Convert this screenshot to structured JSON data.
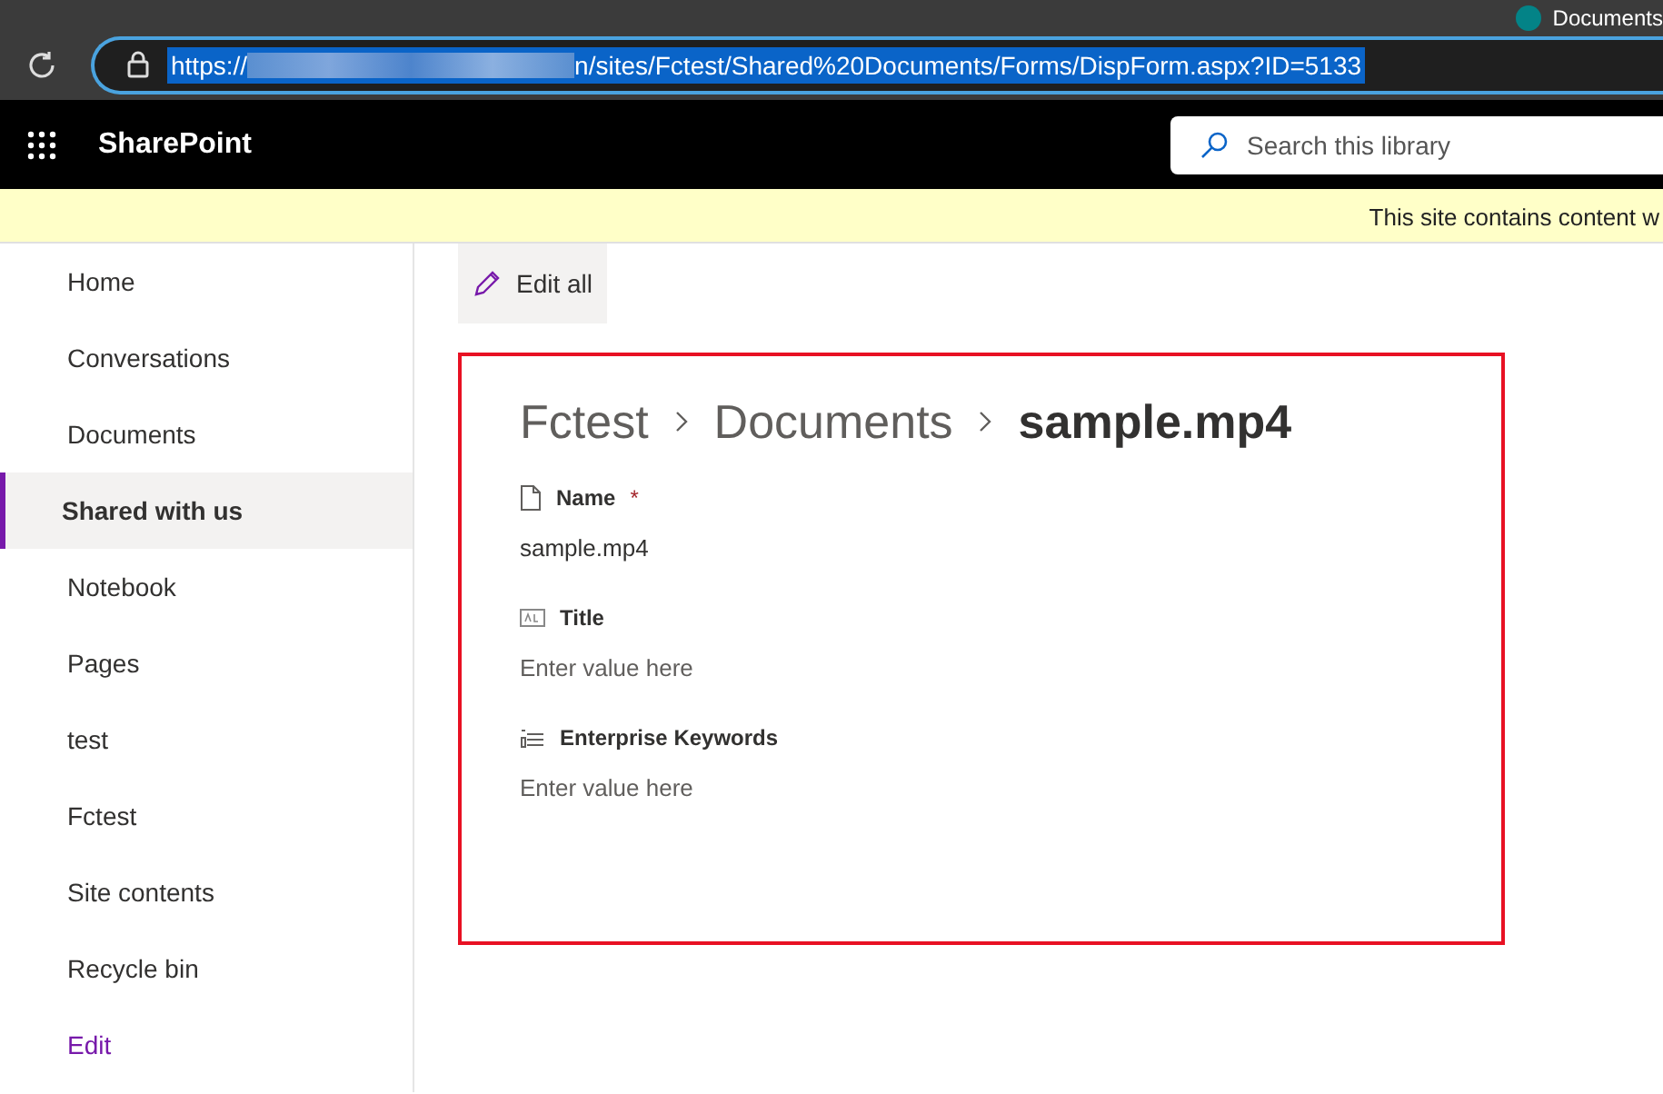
{
  "browser": {
    "tab_title": "Documents",
    "url_prefix": "https://",
    "url_suffix": "n/sites/Fctest/Shared%20Documents/Forms/DispForm.aspx?ID=5133"
  },
  "suite_bar": {
    "app_name": "SharePoint",
    "search": {
      "placeholder": "Search this library"
    }
  },
  "banner": {
    "text": "This site contains content w"
  },
  "nav": [
    {
      "label": "Home",
      "selected": false
    },
    {
      "label": "Conversations",
      "selected": false
    },
    {
      "label": "Documents",
      "selected": false
    },
    {
      "label": "Shared with us",
      "selected": true
    },
    {
      "label": "Notebook",
      "selected": false
    },
    {
      "label": "Pages",
      "selected": false
    },
    {
      "label": "test",
      "selected": false
    },
    {
      "label": "Fctest",
      "selected": false
    },
    {
      "label": "Site contents",
      "selected": false
    },
    {
      "label": "Recycle bin",
      "selected": false
    },
    {
      "label": "Edit",
      "selected": false,
      "kind": "link"
    }
  ],
  "command_bar": {
    "edit_all": "Edit all"
  },
  "form": {
    "breadcrumb": [
      "Fctest",
      "Documents",
      "sample.mp4"
    ],
    "fields": [
      {
        "kind": "file",
        "label": "Name",
        "required_marker": "*",
        "value": "sample.mp4"
      },
      {
        "kind": "text",
        "label": "Title",
        "placeholder": "Enter value here"
      },
      {
        "kind": "keywords",
        "label": "Enterprise Keywords",
        "placeholder": "Enter value here"
      }
    ]
  }
}
